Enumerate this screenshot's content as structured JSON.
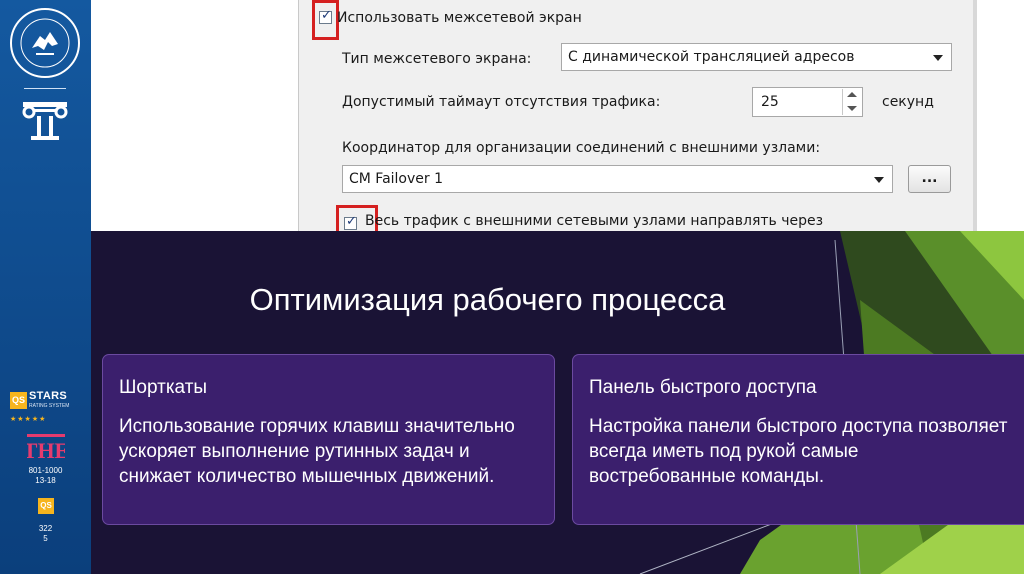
{
  "sidebar": {
    "emblem_icon": "university-emblem-icon",
    "column_icon": "ionic-column-icon",
    "stars_badge": {
      "qs": "QS",
      "label": "STARS",
      "sub": "RATING SYSTEM"
    },
    "the_logo": "THE",
    "the_rank_line1": "801-1000",
    "the_rank_line2": "13-18",
    "qs_small": "QS",
    "qs_rank_line1": "322",
    "qs_rank_line2": "5"
  },
  "dialog": {
    "use_firewall_label": "Использовать межсетевой экран",
    "firewall_type_label": "Тип межсетевого экрана:",
    "firewall_type_value": "С динамической трансляцией адресов",
    "timeout_label": "Допустимый таймаут отсутствия трафика:",
    "timeout_value": "25",
    "timeout_unit": "секунд",
    "coordinator_label": "Координатор для организации соединений с внешними узлами:",
    "coordinator_value": "CM Failover 1",
    "browse_label": "...",
    "route_traffic_label": "Весь трафик с внешними сетевыми узлами направлять через"
  },
  "slide": {
    "title": "Оптимизация рабочего процесса",
    "cards": [
      {
        "heading": "Шорткаты",
        "body": "Использование горячих клавиш значительно ускоряет выполнение рутинных задач и снижает количество мышечных движений."
      },
      {
        "heading": "Панель быстрого доступа",
        "body": "Настройка панели быстрого доступа позволяет всегда иметь под рукой самые востребованные команды."
      }
    ]
  },
  "colors": {
    "sidebar": "#0f4a8a",
    "background": "#1a1335",
    "card": "#3b1f6d",
    "accent_green": "#8dc63f",
    "highlight_red": "#d52020"
  }
}
